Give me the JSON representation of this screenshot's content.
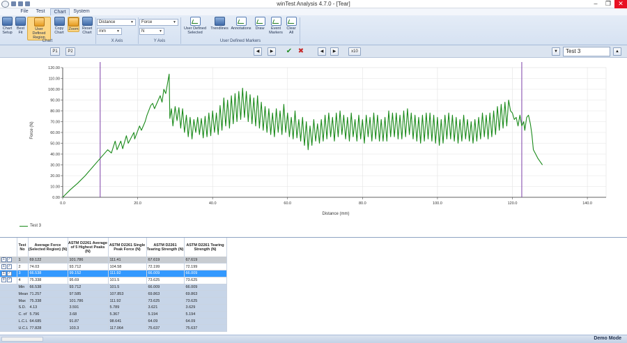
{
  "window": {
    "title": "winTest Analysis 4.7.0 - [Tear]",
    "controls": [
      "minimize",
      "restore",
      "close"
    ]
  },
  "ribbon": {
    "tabs": [
      {
        "label": "File",
        "active": false
      },
      {
        "label": "Test",
        "active": false
      },
      {
        "label": "Chart",
        "active": true
      },
      {
        "label": "System",
        "active": false
      }
    ],
    "chart_group": {
      "label": "Chart",
      "buttons": [
        {
          "label": "Chart Setup",
          "icon": "chart-setup-icon"
        },
        {
          "label": "Best Fit",
          "icon": "best-fit-icon"
        },
        {
          "label": "User Defined Region",
          "icon": "user-region-icon",
          "active": true
        },
        {
          "label": "Copy Chart",
          "icon": "copy-chart-icon"
        },
        {
          "label": "Zoom",
          "icon": "zoom-icon",
          "active": true
        },
        {
          "label": "Reset Chart",
          "icon": "reset-chart-icon"
        }
      ]
    },
    "x_axis": {
      "label": "X Axis",
      "quantity": "Distance",
      "unit": "mm"
    },
    "y_axis": {
      "label": "Y Axis",
      "quantity": "Force",
      "unit": "N"
    },
    "markers_group": {
      "label": "User Defined Markers",
      "buttons": [
        {
          "label": "User Defined Selected",
          "icon": "user-defined-selected-icon"
        },
        {
          "label": "Trendlines",
          "icon": "trendlines-icon"
        },
        {
          "label": "Annotations",
          "icon": "annotations-icon"
        },
        {
          "label": "Draw",
          "icon": "draw-icon"
        },
        {
          "label": "Event Markers",
          "icon": "event-markers-icon"
        },
        {
          "label": "Clear All",
          "icon": "clear-all-icon"
        }
      ]
    }
  },
  "toolbar": {
    "p1_label": "P1",
    "p2_label": "P2",
    "x10_label": "x10",
    "test_selected": "Test 3",
    "accent_check": "#1e8c1e",
    "accent_cross": "#c62828"
  },
  "chart_data": {
    "type": "line",
    "xlabel": "Distance (mm)",
    "ylabel": "Force (N)",
    "xlim": [
      0,
      145
    ],
    "ylim": [
      0,
      120
    ],
    "xticks": [
      "0.0",
      "20.0",
      "40.0",
      "60.0",
      "80.0",
      "100.0",
      "120.0",
      "140.0"
    ],
    "yticks": [
      "0.00",
      "10.00",
      "20.00",
      "30.00",
      "40.00",
      "50.00",
      "60.00",
      "70.00",
      "80.00",
      "90.00",
      "100.00",
      "110.00",
      "120.00"
    ],
    "grid": true,
    "region_markers_x": [
      10,
      122.5
    ],
    "series": [
      {
        "name": "Test 3",
        "color": "#1a8a1a",
        "points": [
          [
            0,
            0
          ],
          [
            2,
            7
          ],
          [
            4,
            13
          ],
          [
            6,
            20
          ],
          [
            8,
            28
          ],
          [
            10,
            36
          ],
          [
            12,
            44
          ],
          [
            13,
            41
          ],
          [
            14,
            52
          ],
          [
            14.5,
            44
          ],
          [
            15.5,
            52
          ],
          [
            16,
            45
          ],
          [
            17,
            57
          ],
          [
            17.5,
            50
          ],
          [
            19,
            60
          ],
          [
            19.2,
            54
          ],
          [
            20.5,
            66
          ],
          [
            21,
            62
          ],
          [
            22,
            70
          ],
          [
            22.5,
            76
          ],
          [
            23.5,
            85
          ],
          [
            24,
            87
          ],
          [
            24.5,
            82
          ],
          [
            25.5,
            90
          ],
          [
            26,
            94
          ],
          [
            26.5,
            88
          ],
          [
            27,
            100
          ],
          [
            27.5,
            96
          ],
          [
            28.4,
            114
          ],
          [
            28.6,
            73
          ],
          [
            29,
            82
          ],
          [
            29.4,
            66
          ],
          [
            30,
            84
          ],
          [
            30.5,
            71
          ],
          [
            31,
            83
          ],
          [
            31.5,
            64
          ],
          [
            32,
            82
          ],
          [
            32.5,
            60
          ],
          [
            33,
            76
          ],
          [
            33.5,
            56
          ],
          [
            34,
            74
          ],
          [
            34.5,
            54
          ],
          [
            35,
            72
          ],
          [
            35.5,
            60
          ],
          [
            36,
            74
          ],
          [
            36.5,
            58
          ],
          [
            37,
            73
          ],
          [
            37.5,
            55
          ],
          [
            38,
            75
          ],
          [
            38.5,
            56
          ],
          [
            39,
            78
          ],
          [
            39.5,
            57
          ],
          [
            40,
            80
          ],
          [
            40.5,
            60
          ],
          [
            41,
            78
          ],
          [
            41.5,
            58
          ],
          [
            42,
            85
          ],
          [
            42.5,
            62
          ],
          [
            43,
            92
          ],
          [
            43.5,
            66
          ],
          [
            44,
            90
          ],
          [
            44.5,
            64
          ],
          [
            45,
            94
          ],
          [
            45.5,
            68
          ],
          [
            46,
            96
          ],
          [
            46.5,
            70
          ],
          [
            47,
            98
          ],
          [
            47.5,
            72
          ],
          [
            48,
            101
          ],
          [
            48.5,
            74
          ],
          [
            49,
            98
          ],
          [
            49.5,
            70
          ],
          [
            50,
            95
          ],
          [
            50.5,
            68
          ],
          [
            51,
            92
          ],
          [
            51.5,
            66
          ],
          [
            52,
            94
          ],
          [
            52.5,
            64
          ],
          [
            53,
            88
          ],
          [
            53.5,
            62
          ],
          [
            54,
            84
          ],
          [
            54.5,
            60
          ],
          [
            55,
            82
          ],
          [
            55.5,
            58
          ],
          [
            56,
            78
          ],
          [
            56.5,
            56
          ],
          [
            57,
            82
          ],
          [
            57.5,
            60
          ],
          [
            58,
            80
          ],
          [
            58.5,
            58
          ],
          [
            59,
            86
          ],
          [
            59.5,
            60
          ],
          [
            60,
            78
          ],
          [
            60.5,
            56
          ],
          [
            61,
            74
          ],
          [
            61.5,
            54
          ],
          [
            62,
            80
          ],
          [
            62.5,
            55
          ],
          [
            63,
            72
          ],
          [
            63.5,
            52
          ],
          [
            64,
            74
          ],
          [
            64.5,
            48
          ],
          [
            65,
            70
          ],
          [
            65.5,
            44
          ],
          [
            66,
            66
          ],
          [
            66.5,
            48
          ],
          [
            67,
            72
          ],
          [
            67.5,
            52
          ],
          [
            68,
            68
          ],
          [
            68.5,
            50
          ],
          [
            69,
            72
          ],
          [
            69.5,
            52
          ],
          [
            70,
            76
          ],
          [
            70.5,
            54
          ],
          [
            71,
            78
          ],
          [
            71.5,
            56
          ],
          [
            72,
            74
          ],
          [
            72.5,
            52
          ],
          [
            73,
            78
          ],
          [
            73.5,
            56
          ],
          [
            74,
            80
          ],
          [
            74.5,
            58
          ],
          [
            75,
            76
          ],
          [
            75.5,
            54
          ],
          [
            76,
            74
          ],
          [
            76.5,
            52
          ],
          [
            77,
            78
          ],
          [
            77.5,
            56
          ],
          [
            78,
            72
          ],
          [
            78.5,
            52
          ],
          [
            79,
            76
          ],
          [
            79.5,
            54
          ],
          [
            80,
            72
          ],
          [
            80.5,
            50
          ],
          [
            81,
            76
          ],
          [
            81.5,
            56
          ],
          [
            82,
            74
          ],
          [
            82.5,
            52
          ],
          [
            83,
            78
          ],
          [
            83.5,
            54
          ],
          [
            84,
            76
          ],
          [
            84.5,
            52
          ],
          [
            85,
            72
          ],
          [
            85.5,
            52
          ],
          [
            86,
            74
          ],
          [
            86.5,
            52
          ],
          [
            87,
            80
          ],
          [
            87.5,
            56
          ],
          [
            88,
            78
          ],
          [
            88.5,
            56
          ],
          [
            89,
            78
          ],
          [
            89.5,
            54
          ],
          [
            90,
            76
          ],
          [
            90.5,
            54
          ],
          [
            91,
            80
          ],
          [
            91.5,
            56
          ],
          [
            92,
            82
          ],
          [
            92.5,
            58
          ],
          [
            93,
            78
          ],
          [
            93.5,
            54
          ],
          [
            94,
            76
          ],
          [
            94.5,
            52
          ],
          [
            95,
            74
          ],
          [
            95.5,
            50
          ],
          [
            96,
            76
          ],
          [
            96.5,
            52
          ],
          [
            97,
            78
          ],
          [
            97.5,
            54
          ],
          [
            98,
            78
          ],
          [
            98.5,
            52
          ],
          [
            99,
            76
          ],
          [
            99.5,
            50
          ],
          [
            100,
            74
          ],
          [
            100.5,
            48
          ],
          [
            101,
            72
          ],
          [
            101.5,
            50
          ],
          [
            102,
            76
          ],
          [
            102.5,
            54
          ],
          [
            103,
            78
          ],
          [
            103.5,
            54
          ],
          [
            104,
            76
          ],
          [
            104.5,
            52
          ],
          [
            105,
            74
          ],
          [
            105.5,
            50
          ],
          [
            106,
            72
          ],
          [
            106.5,
            52
          ],
          [
            107,
            76
          ],
          [
            107.5,
            54
          ],
          [
            108,
            72
          ],
          [
            108.5,
            52
          ],
          [
            109,
            70
          ],
          [
            109.5,
            50
          ],
          [
            110,
            72
          ],
          [
            110.5,
            52
          ],
          [
            111,
            74
          ],
          [
            111.5,
            54
          ],
          [
            112,
            78
          ],
          [
            112.5,
            56
          ],
          [
            113,
            76
          ],
          [
            113.5,
            54
          ],
          [
            114,
            78
          ],
          [
            114.5,
            56
          ],
          [
            115,
            80
          ],
          [
            115.5,
            58
          ],
          [
            116,
            84
          ],
          [
            116.5,
            62
          ],
          [
            117,
            86
          ],
          [
            117.5,
            64
          ],
          [
            118,
            88
          ],
          [
            118.5,
            66
          ],
          [
            119,
            90
          ],
          [
            119.5,
            80
          ],
          [
            120,
            78
          ],
          [
            120.5,
            72
          ],
          [
            121,
            74
          ],
          [
            121.5,
            66
          ],
          [
            122,
            76
          ],
          [
            122.5,
            66
          ],
          [
            123,
            70
          ],
          [
            123.3,
            62
          ],
          [
            123.8,
            74
          ],
          [
            124.3,
            76
          ],
          [
            124.8,
            68
          ],
          [
            125.2,
            58
          ],
          [
            125.6,
            44
          ],
          [
            126.2,
            40
          ],
          [
            126.8,
            36
          ],
          [
            127.4,
            33
          ],
          [
            128,
            30
          ]
        ]
      }
    ],
    "legend": {
      "position": "bottom-left",
      "entries": [
        "Test 3"
      ]
    }
  },
  "results_table": {
    "columns": [
      "Test No",
      "Average Force (Selected Region) (N)",
      "ASTM D2261 Average of 5 Highest Peaks (N)",
      "ASTM D2261 Single Peak Force (N)",
      "ASTM D2261 Tearing Strength (N)",
      "ASTM D2261 Tearing Strength (N)"
    ],
    "test_rows": [
      {
        "no": "1",
        "values": [
          "69.122",
          "101.786",
          "111.41",
          "67.619",
          "67.619"
        ],
        "style": "gray"
      },
      {
        "no": "2",
        "values": [
          "74.03",
          "93.712",
          "104.58",
          "72.199",
          "72.199"
        ],
        "style": "white"
      },
      {
        "no": "3",
        "values": [
          "66.538",
          "99.152",
          "111.92",
          "66.009",
          "66.009"
        ],
        "style": "selected"
      },
      {
        "no": "4",
        "values": [
          "75.338",
          "95.69",
          "101.5",
          "73.625",
          "73.625"
        ],
        "style": "white"
      }
    ],
    "stat_rows": [
      {
        "label": "Min",
        "values": [
          "66.538",
          "93.712",
          "101.5",
          "66.009",
          "66.009"
        ]
      },
      {
        "label": "Mean",
        "values": [
          "71.257",
          "97.585",
          "107.853",
          "69.863",
          "69.863"
        ]
      },
      {
        "label": "Max",
        "values": [
          "75.338",
          "101.786",
          "111.92",
          "73.625",
          "73.625"
        ]
      },
      {
        "label": "S.D.",
        "values": [
          "4.13",
          "3.591",
          "5.789",
          "3.621",
          "3.629"
        ]
      },
      {
        "label": "C. of V.",
        "values": [
          "5.796",
          "3.68",
          "5.367",
          "5.194",
          "5.194"
        ]
      },
      {
        "label": "L.C.L.",
        "values": [
          "64.685",
          "91.87",
          "98.641",
          "64.09",
          "64.09"
        ]
      },
      {
        "label": "U.C.L.",
        "values": [
          "77.828",
          "103.3",
          "117.064",
          "75.637",
          "75.637"
        ]
      }
    ]
  },
  "status": {
    "mode": "Demo Mode"
  }
}
